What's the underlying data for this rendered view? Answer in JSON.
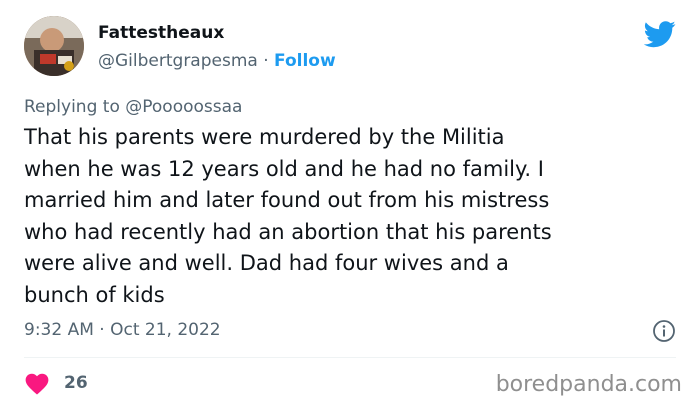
{
  "author": {
    "display_name": "Fattestheaux",
    "handle": "@Gilbertgrapesma",
    "separator": "·",
    "follow_label": "Follow"
  },
  "reply": {
    "prefix": "Replying to",
    "mention": "@Pooooossaa"
  },
  "tweet": {
    "text": "That his parents were murdered by the Militia\nwhen he was 12 years old and he had no family. I\nmarried him and later found out from his mistress\nwho had recently had an abortion that his parents\nwere alive and well. Dad had four wives and a\nbunch of kids",
    "timestamp": "9:32 AM · Oct 21, 2022"
  },
  "engagement": {
    "likes": "26"
  },
  "watermark": "boredpanda.com",
  "icons": {
    "brand": "twitter-bird-icon",
    "info": "info-icon",
    "like": "heart-icon"
  },
  "colors": {
    "accent": "#1d9bf0",
    "like": "#f91880",
    "muted": "#536471",
    "text": "#0f1419"
  }
}
